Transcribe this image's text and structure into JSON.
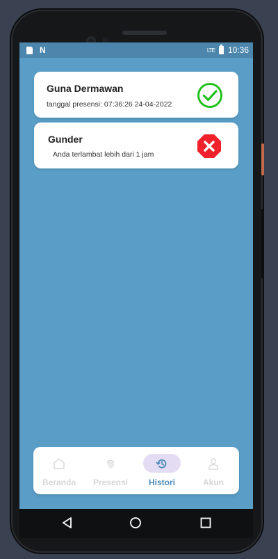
{
  "statusbar": {
    "time": "10:36",
    "signal_text": "LTE"
  },
  "cards": [
    {
      "name": "Guna Dermawan",
      "detail": "tanggal presensi:  07:36:26 24-04-2022",
      "status": "success",
      "status_color": "#22c11f"
    },
    {
      "name": "Gunder",
      "detail": "Anda terlambat lebih dari 1 jam",
      "status": "failed",
      "status_color": "#f0212b"
    }
  ],
  "bottom_nav": {
    "items": [
      {
        "label": "Beranda",
        "icon": "home-icon"
      },
      {
        "label": "Presensi",
        "icon": "fingerprint-icon"
      },
      {
        "label": "Histori",
        "icon": "history-icon",
        "active": true
      },
      {
        "label": "Akun",
        "icon": "user-icon"
      }
    ]
  },
  "colors": {
    "screen_bg": "#5a9ec7",
    "statusbar_bg": "#4d86ad",
    "active_nav": "#4b8ab8",
    "active_nav_bg": "#e3dcf3",
    "inactive_nav": "#d6d6d6"
  }
}
